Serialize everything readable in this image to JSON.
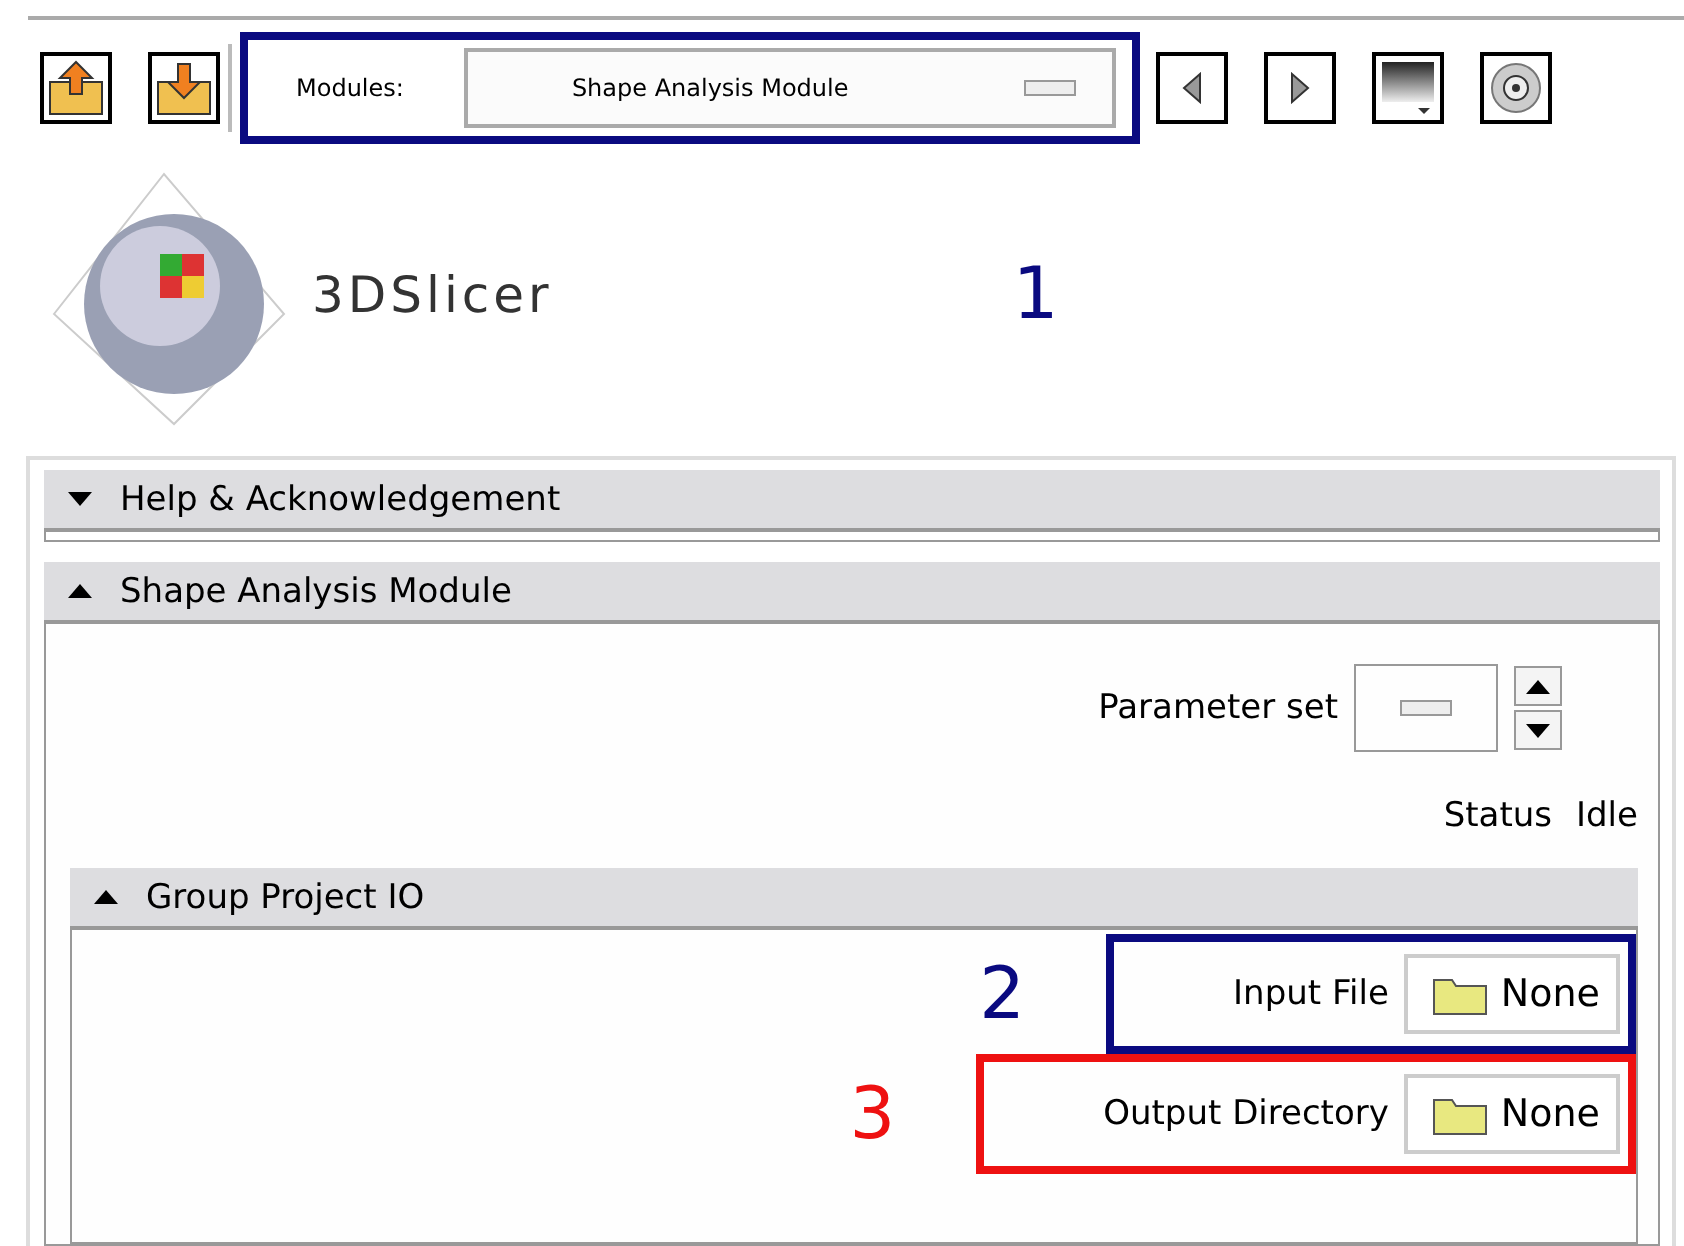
{
  "toolbar": {
    "modules": {
      "label": "Modules:",
      "value": "Shape Analysis Module",
      "callout": {
        "number": "1",
        "color": "#0a0a80"
      }
    }
  },
  "logo": {
    "text": "3DSlicer"
  },
  "sections": [
    {
      "title": "Help & Acknowledgement",
      "expanded": false
    },
    {
      "title": "Shape Analysis Module",
      "expanded": true,
      "parameter_set": {
        "label": "Parameter set"
      },
      "status": {
        "label": "Status",
        "value": "Idle"
      },
      "group": {
        "title": "Group Project IO",
        "expanded": true,
        "rows": [
          {
            "label": "Input File",
            "value": "None",
            "callout": {
              "number": "2",
              "color": "#0a0a80"
            }
          },
          {
            "label": "Output Directory",
            "value": "None",
            "callout": {
              "number": "3",
              "color": "#ee1111"
            }
          }
        ]
      }
    }
  ]
}
